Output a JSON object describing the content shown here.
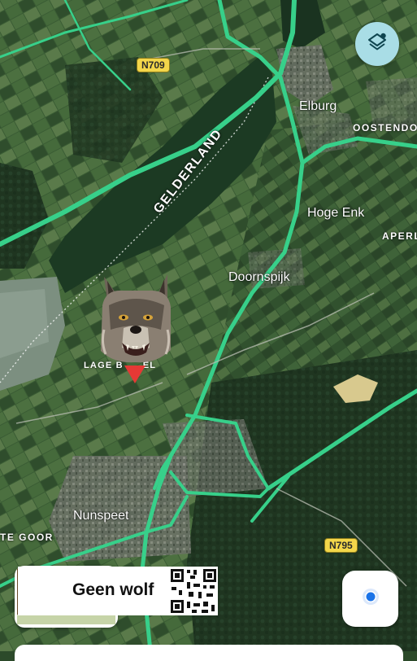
{
  "map": {
    "place_labels": {
      "elburg": "Elburg",
      "oostendorp": "OOSTENDO",
      "hoge_enk": "Hoge Enk",
      "aperloo": "APERL",
      "gelderland": "GELDERLAND",
      "doornspijk": "Doornspijk",
      "lage_bussel": "LAGE B",
      "lage_bussel_end": "EL",
      "nunspeet": "Nunspeet",
      "te_goor": "TE GOOR"
    },
    "road_shields": {
      "n709": "N709",
      "n795": "N795"
    }
  },
  "controls": {
    "layers_icon": "layers-icon",
    "my_location_icon": "my-location-icon"
  },
  "sticker": {
    "banner_text": "Geen wolf"
  },
  "colors": {
    "road": "#37d08a",
    "water": "#1c3a23",
    "layers_button": "#a9dde6",
    "location_dot": "#1a73e8",
    "pin": "#e53935"
  }
}
